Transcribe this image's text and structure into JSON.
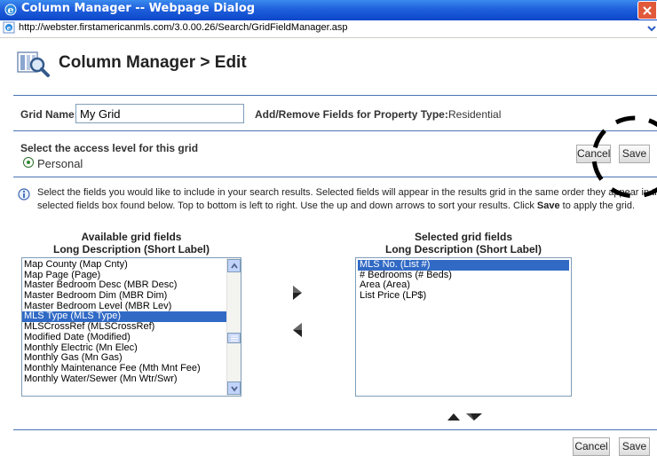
{
  "window": {
    "title": "Column Manager -- Webpage Dialog",
    "url": "http://webster.firstamericanmls.com/3.0.00.26/Search/GridFieldManager.asp",
    "icon": "ie-icon"
  },
  "header": {
    "title": "Column Manager > Edit",
    "icon": "column-manager-icon"
  },
  "grid_name": {
    "label": "Grid Name:",
    "value": "My Grid"
  },
  "property_type": {
    "label": "Add/Remove Fields for Property Type:",
    "value": "Residential"
  },
  "access": {
    "label": "Select the access level for this grid",
    "option": "Personal",
    "selected": true
  },
  "buttons": {
    "cancel": "Cancel",
    "save": "Save"
  },
  "info": {
    "line1": "Select the fields you would like to include in your search results. Selected fields will appear in the results grid in the same order they appear in the",
    "line2": "selected fields box found below. Top to bottom is left to right. Use the up and down arrows to sort your results. Click Save to apply the grid.",
    "line2_pre": "selected fields box found below. Top to bottom is left to right. Use the up and down arrows to sort your results. Click ",
    "line2_bold": "Save",
    "line2_post": " to apply the grid."
  },
  "available": {
    "heading1": "Available grid fields",
    "heading2": "Long Description (Short Label)",
    "items": [
      "Map County (Map Cnty)",
      "Map Page (Page)",
      "Master Bedroom Desc (MBR Desc)",
      "Master Bedroom Dim (MBR Dim)",
      "Master Bedroom Level (MBR Lev)",
      "MLS Type (MLS Type)",
      "MLSCrossRef (MLSCrossRef)",
      "Modified Date (Modified)",
      "Monthly Electric (Mn Elec)",
      "Monthly Gas (Mn Gas)",
      "Monthly Maintenance Fee (Mth Mnt Fee)",
      "Monthly Water/Sewer (Mn Wtr/Swr)"
    ],
    "selected_index": 5
  },
  "selected": {
    "heading1": "Selected grid fields",
    "heading2": "Long Description (Short Label)",
    "items": [
      "MLS No. (List #)",
      "# Bedrooms (# Beds)",
      "Area (Area)",
      "List Price (LP$)"
    ],
    "selected_index": 0
  },
  "colors": {
    "titlebar": "#0b47c9",
    "selection": "#316ac5",
    "rule": "#4b73b3"
  }
}
